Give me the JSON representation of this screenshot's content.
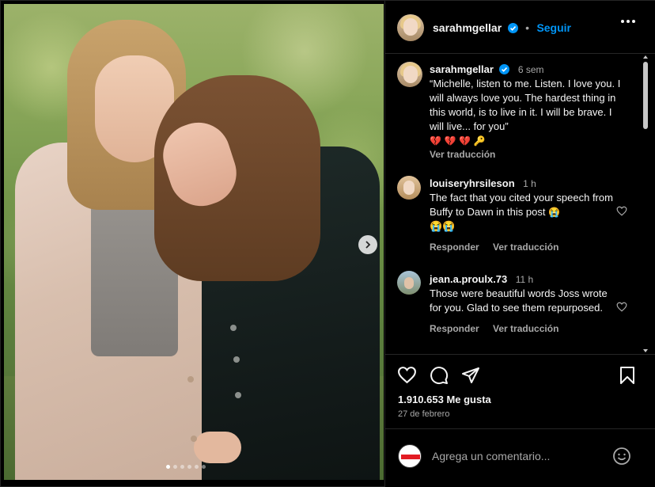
{
  "colors": {
    "accent": "#0095f6",
    "background": "#000000",
    "muted": "#a8a8a8",
    "text": "#f5f5f5"
  },
  "header": {
    "username": "sarahmgellar",
    "separator": "•",
    "follow_label": "Seguir",
    "more_icon": "more-horizontal-icon"
  },
  "caption": {
    "username": "sarahmgellar",
    "time": "6 sem",
    "text": "“Michelle, listen to me. Listen. I love you. I will always love you. The hardest thing in this world, is to live in it. I will be brave. I will live... for you”",
    "emojis": [
      "💔",
      "💔",
      "💔",
      "🔑"
    ],
    "translate_label": "Ver traducción"
  },
  "comments": [
    {
      "username": "louiseryhrsileson",
      "time": "1 h",
      "text": "The fact that you cited your speech from Buffy to Dawn in this post",
      "emojis_inline": "😭",
      "emojis_line": "😭😭",
      "reply_label": "Responder",
      "translate_label": "Ver traducción"
    },
    {
      "username": "jean.a.proulx.73",
      "time": "11 h",
      "text": "Those were beautiful words Joss wrote for you. Glad to see them repurposed.",
      "reply_label": "Responder",
      "translate_label": "Ver traducción"
    }
  ],
  "actions": {
    "like_icon": "heart-icon",
    "comment_icon": "comment-icon",
    "share_icon": "share-icon",
    "save_icon": "bookmark-icon"
  },
  "likes_text": "1.910.653 Me gusta",
  "date_text": "27 de febrero",
  "composer": {
    "placeholder": "Agrega un comentario...",
    "emoji_icon": "emoji-smile-icon"
  },
  "carousel": {
    "total_dots": 6,
    "active_dot": 0
  }
}
